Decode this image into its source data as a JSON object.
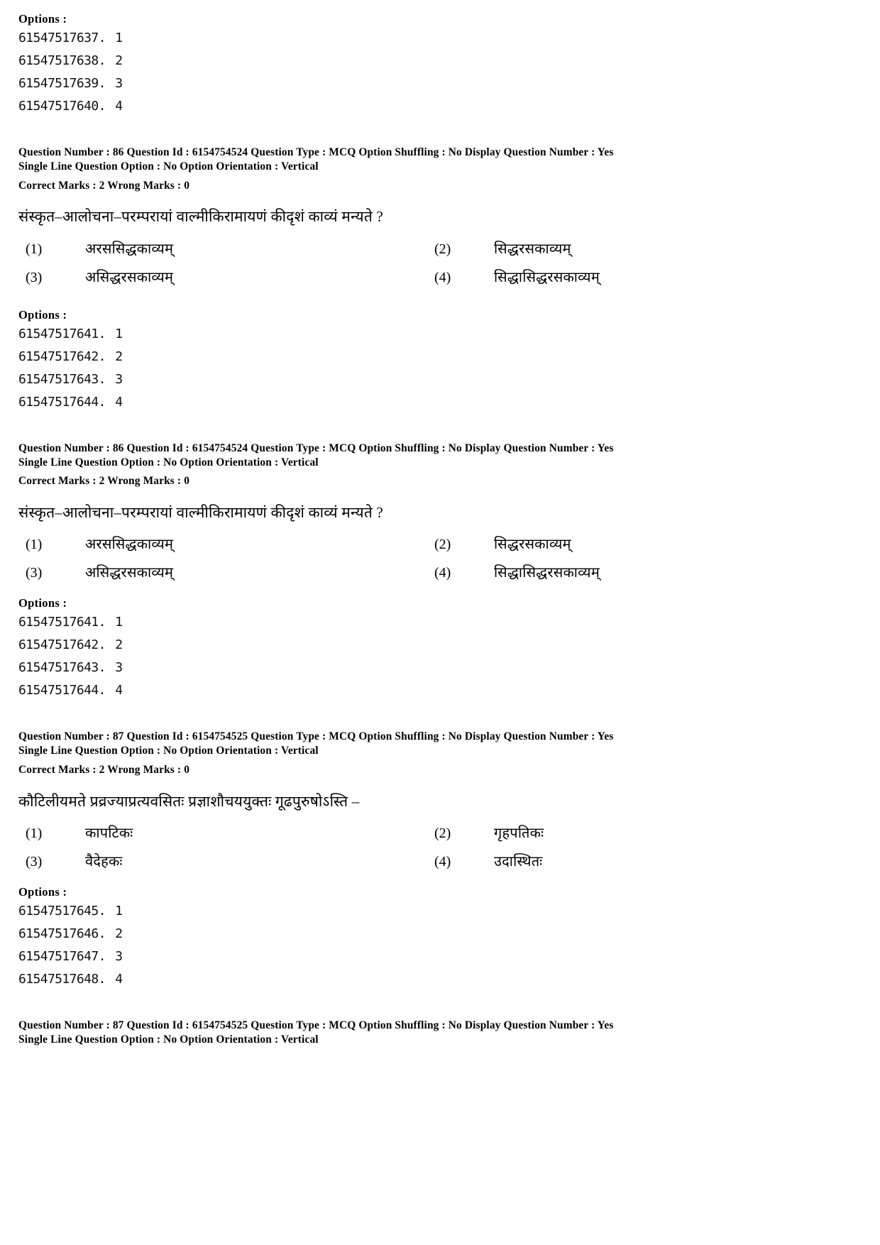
{
  "labels": {
    "options_heading": "Options :"
  },
  "top_option_ids": [
    {
      "id": "61547517637",
      "num": "1"
    },
    {
      "id": "61547517638",
      "num": "2"
    },
    {
      "id": "61547517639",
      "num": "3"
    },
    {
      "id": "61547517640",
      "num": "4"
    }
  ],
  "blocks": [
    {
      "meta_line1": "Question Number : 86  Question Id : 6154754524  Question Type : MCQ  Option Shuffling : No  Display Question Number : Yes",
      "meta_line2": "Single Line Question Option : No  Option Orientation : Vertical",
      "meta_marks": "Correct Marks : 2  Wrong Marks : 0",
      "question": "संस्कृत–आलोचना–परम्परायां वाल्मीकिरामायणं कीदृशं काव्यं मन्यते ?",
      "choices": [
        {
          "marker": "(1)",
          "text": "अरससिद्धकाव्यम्"
        },
        {
          "marker": "(2)",
          "text": "सिद्धरसकाव्यम्"
        },
        {
          "marker": "(3)",
          "text": "असिद्धरसकाव्यम्"
        },
        {
          "marker": "(4)",
          "text": "सिद्धासिद्धरसकाव्यम्"
        }
      ],
      "options_heading": "Options :",
      "option_ids": [
        {
          "id": "61547517641",
          "num": "1"
        },
        {
          "id": "61547517642",
          "num": "2"
        },
        {
          "id": "61547517643",
          "num": "3"
        },
        {
          "id": "61547517644",
          "num": "4"
        }
      ]
    },
    {
      "meta_line1": "Question Number : 86  Question Id : 6154754524  Question Type : MCQ  Option Shuffling : No  Display Question Number : Yes",
      "meta_line2": "Single Line Question Option : No  Option Orientation : Vertical",
      "meta_marks": "Correct Marks : 2  Wrong Marks : 0",
      "question": "संस्कृत–आलोचना–परम्परायां वाल्मीकिरामायणं कीदृशं काव्यं मन्यते ?",
      "choices": [
        {
          "marker": "(1)",
          "text": "अरससिद्धकाव्यम्"
        },
        {
          "marker": "(2)",
          "text": "सिद्धरसकाव्यम्"
        },
        {
          "marker": "(3)",
          "text": "असिद्धरसकाव्यम्"
        },
        {
          "marker": "(4)",
          "text": "सिद्धासिद्धरसकाव्यम्"
        }
      ],
      "options_heading": "Options :",
      "option_ids": [
        {
          "id": "61547517641",
          "num": "1"
        },
        {
          "id": "61547517642",
          "num": "2"
        },
        {
          "id": "61547517643",
          "num": "3"
        },
        {
          "id": "61547517644",
          "num": "4"
        }
      ]
    },
    {
      "meta_line1": "Question Number : 87  Question Id : 6154754525  Question Type : MCQ  Option Shuffling : No  Display Question Number : Yes",
      "meta_line2": "Single Line Question Option : No  Option Orientation : Vertical",
      "meta_marks": "Correct Marks : 2  Wrong Marks : 0",
      "question": "कौटिलीयमते प्रव्रज्याप्रत्यवसितः प्रज्ञाशौचययुक्तः गूढपुरुषोऽस्ति  –",
      "choices": [
        {
          "marker": "(1)",
          "text": "कापटिकः"
        },
        {
          "marker": "(2)",
          "text": "गृहपतिकः"
        },
        {
          "marker": "(3)",
          "text": "वैदेहकः"
        },
        {
          "marker": "(4)",
          "text": "उदास्थितः"
        }
      ],
      "options_heading": "Options :",
      "option_ids": [
        {
          "id": "61547517645",
          "num": "1"
        },
        {
          "id": "61547517646",
          "num": "2"
        },
        {
          "id": "61547517647",
          "num": "3"
        },
        {
          "id": "61547517648",
          "num": "4"
        }
      ]
    }
  ],
  "footer": {
    "meta_line1": "Question Number : 87  Question Id : 6154754525  Question Type : MCQ  Option Shuffling : No  Display Question Number : Yes",
    "meta_line2": "Single Line Question Option : No  Option Orientation : Vertical"
  }
}
